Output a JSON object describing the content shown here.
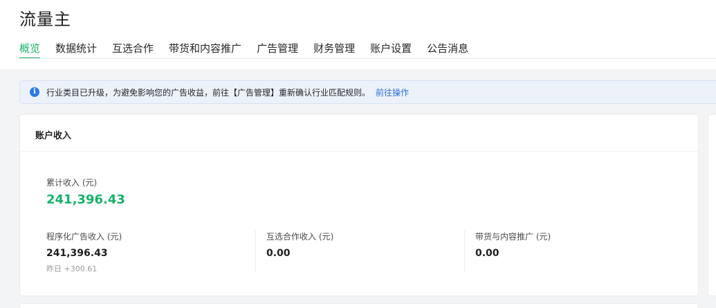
{
  "app": {
    "title": "流量主"
  },
  "tabs": [
    {
      "label": "概览",
      "active": true
    },
    {
      "label": "数据统计",
      "active": false
    },
    {
      "label": "互选合作",
      "active": false
    },
    {
      "label": "带货和内容推广",
      "active": false
    },
    {
      "label": "广告管理",
      "active": false
    },
    {
      "label": "财务管理",
      "active": false
    },
    {
      "label": "账户设置",
      "active": false
    },
    {
      "label": "公告消息",
      "active": false
    }
  ],
  "notice": {
    "text": "行业类目已升级，为避免影响您的广告收益，前往【广告管理】重新确认行业匹配规则。",
    "link": "前往操作",
    "icon": "info-icon"
  },
  "account_income": {
    "title": "账户收入",
    "total_label": "累计收入 (元)",
    "total_value": "241,396.43",
    "metrics": [
      {
        "label": "程序化广告收入 (元)",
        "value": "241,396.43",
        "sub": "昨日 +300.61"
      },
      {
        "label": "互选合作收入 (元)",
        "value": "0.00",
        "sub": ""
      },
      {
        "label": "带货与内容推广 (元)",
        "value": "0.00",
        "sub": ""
      }
    ]
  },
  "colors": {
    "accent": "#17b26a",
    "link": "#2c6fd8",
    "info": "#2c7be5"
  }
}
